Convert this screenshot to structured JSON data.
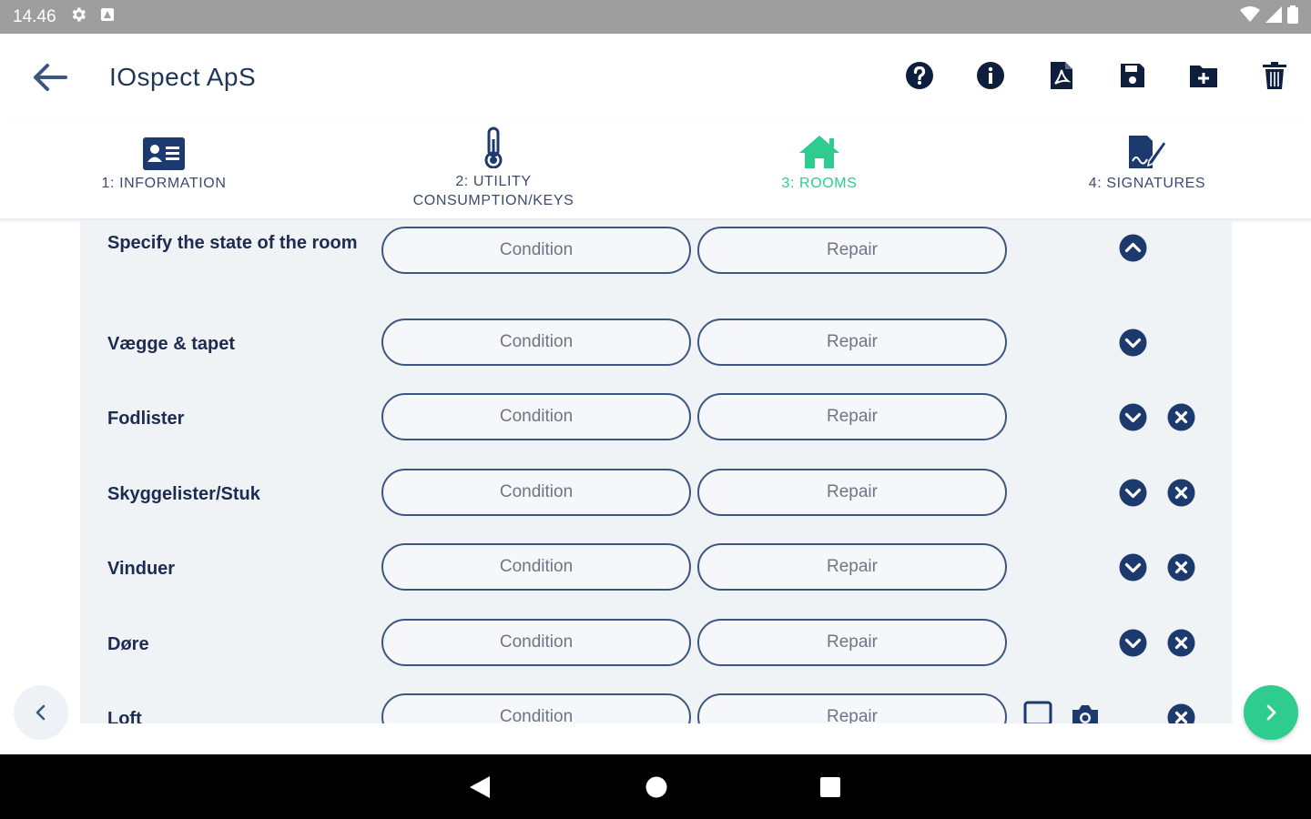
{
  "status_bar": {
    "time": "14.46",
    "icons": [
      "gear-icon",
      "notification-icon",
      "wifi-icon",
      "cell-signal-icon",
      "battery-icon"
    ]
  },
  "app_bar": {
    "title": "IOspect ApS",
    "actions": [
      "help-icon",
      "info-icon",
      "pdf-icon",
      "save-icon",
      "add-folder-icon",
      "trash-icon"
    ]
  },
  "tabs": [
    {
      "label": "1: INFORMATION",
      "icon": "id-card-icon",
      "active": false
    },
    {
      "label_line1": "2: UTILITY",
      "label_line2": "CONSUMPTION/KEYS",
      "icon": "thermometer-icon",
      "active": false
    },
    {
      "label": "3: ROOMS",
      "icon": "house-icon",
      "active": true
    },
    {
      "label": "4: SIGNATURES",
      "icon": "signature-icon",
      "active": false
    }
  ],
  "rows": [
    {
      "label": "Specify the state of the room",
      "condition": "Condition",
      "repair": "Repair"
    },
    {
      "label": "Vægge & tapet",
      "condition": "Condition",
      "repair": "Repair"
    },
    {
      "label": "Fodlister",
      "condition": "Condition",
      "repair": "Repair"
    },
    {
      "label": "Skyggelister/Stuk",
      "condition": "Condition",
      "repair": "Repair"
    },
    {
      "label": "Vinduer",
      "condition": "Condition",
      "repair": "Repair"
    },
    {
      "label": "Døre",
      "condition": "Condition",
      "repair": "Repair"
    },
    {
      "label": "Loft",
      "condition": "Condition",
      "repair": "Repair"
    }
  ],
  "colors": {
    "primary": "#1d3a6e",
    "accent": "#2ecc8f",
    "content_bg": "#f0f3f6"
  }
}
